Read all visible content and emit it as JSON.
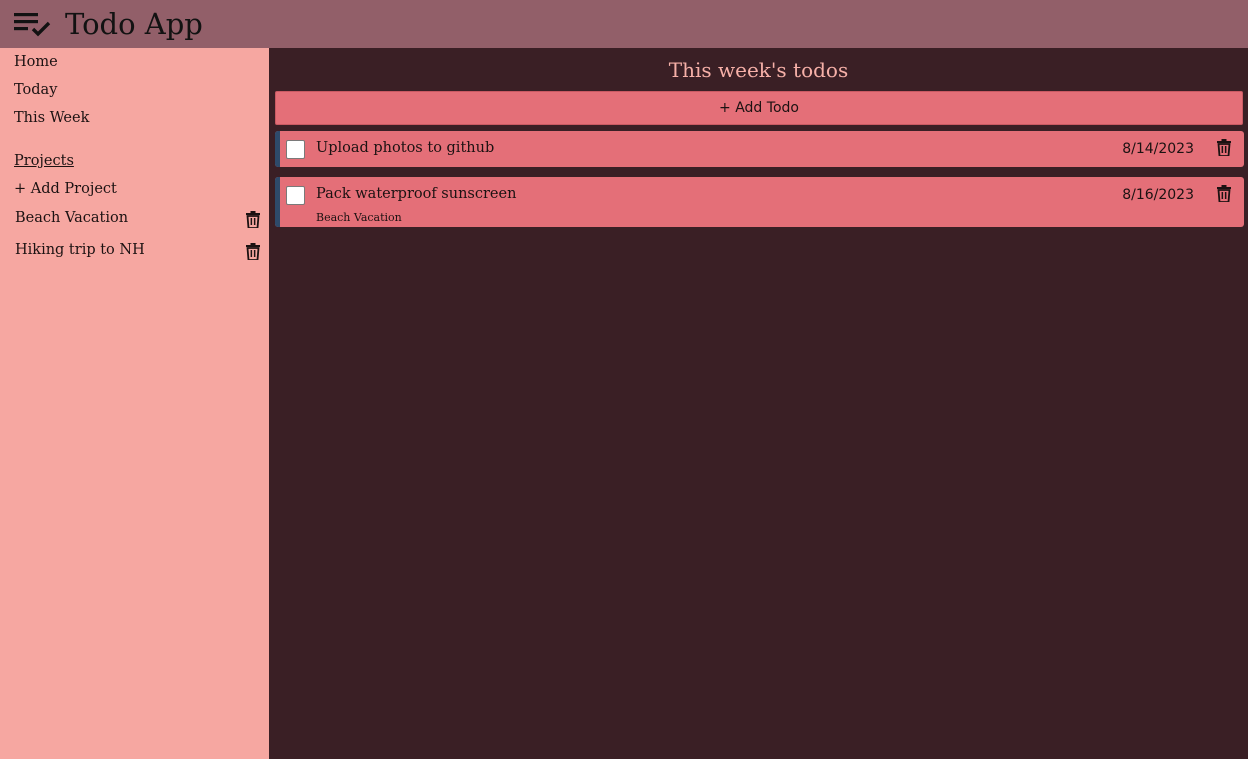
{
  "header": {
    "title": "Todo App",
    "logo_icon": "checklist-icon"
  },
  "sidebar": {
    "nav": [
      {
        "label": "Home"
      },
      {
        "label": "Today"
      },
      {
        "label": "This Week"
      }
    ],
    "projects_heading": "Projects",
    "add_project_label": "+ Add Project",
    "projects": [
      {
        "name": "Beach Vacation",
        "delete_icon": "trash-icon"
      },
      {
        "name": "Hiking trip to NH",
        "delete_icon": "trash-icon"
      }
    ]
  },
  "main": {
    "title": "This week's todos",
    "add_todo_label": "+ Add Todo",
    "todos": [
      {
        "text": "Upload photos to github",
        "date": "8/14/2023",
        "project": "",
        "checked": false
      },
      {
        "text": "Pack waterproof sunscreen",
        "date": "8/16/2023",
        "project": "Beach Vacation",
        "checked": false
      }
    ]
  },
  "colors": {
    "header_bg": "#925f69",
    "sidebar_bg": "#f6a7a1",
    "main_bg": "#3a1f25",
    "todo_bg": "#e46f78",
    "accent_bar": "#2e4a6a",
    "title_text": "#f6b0a8"
  }
}
